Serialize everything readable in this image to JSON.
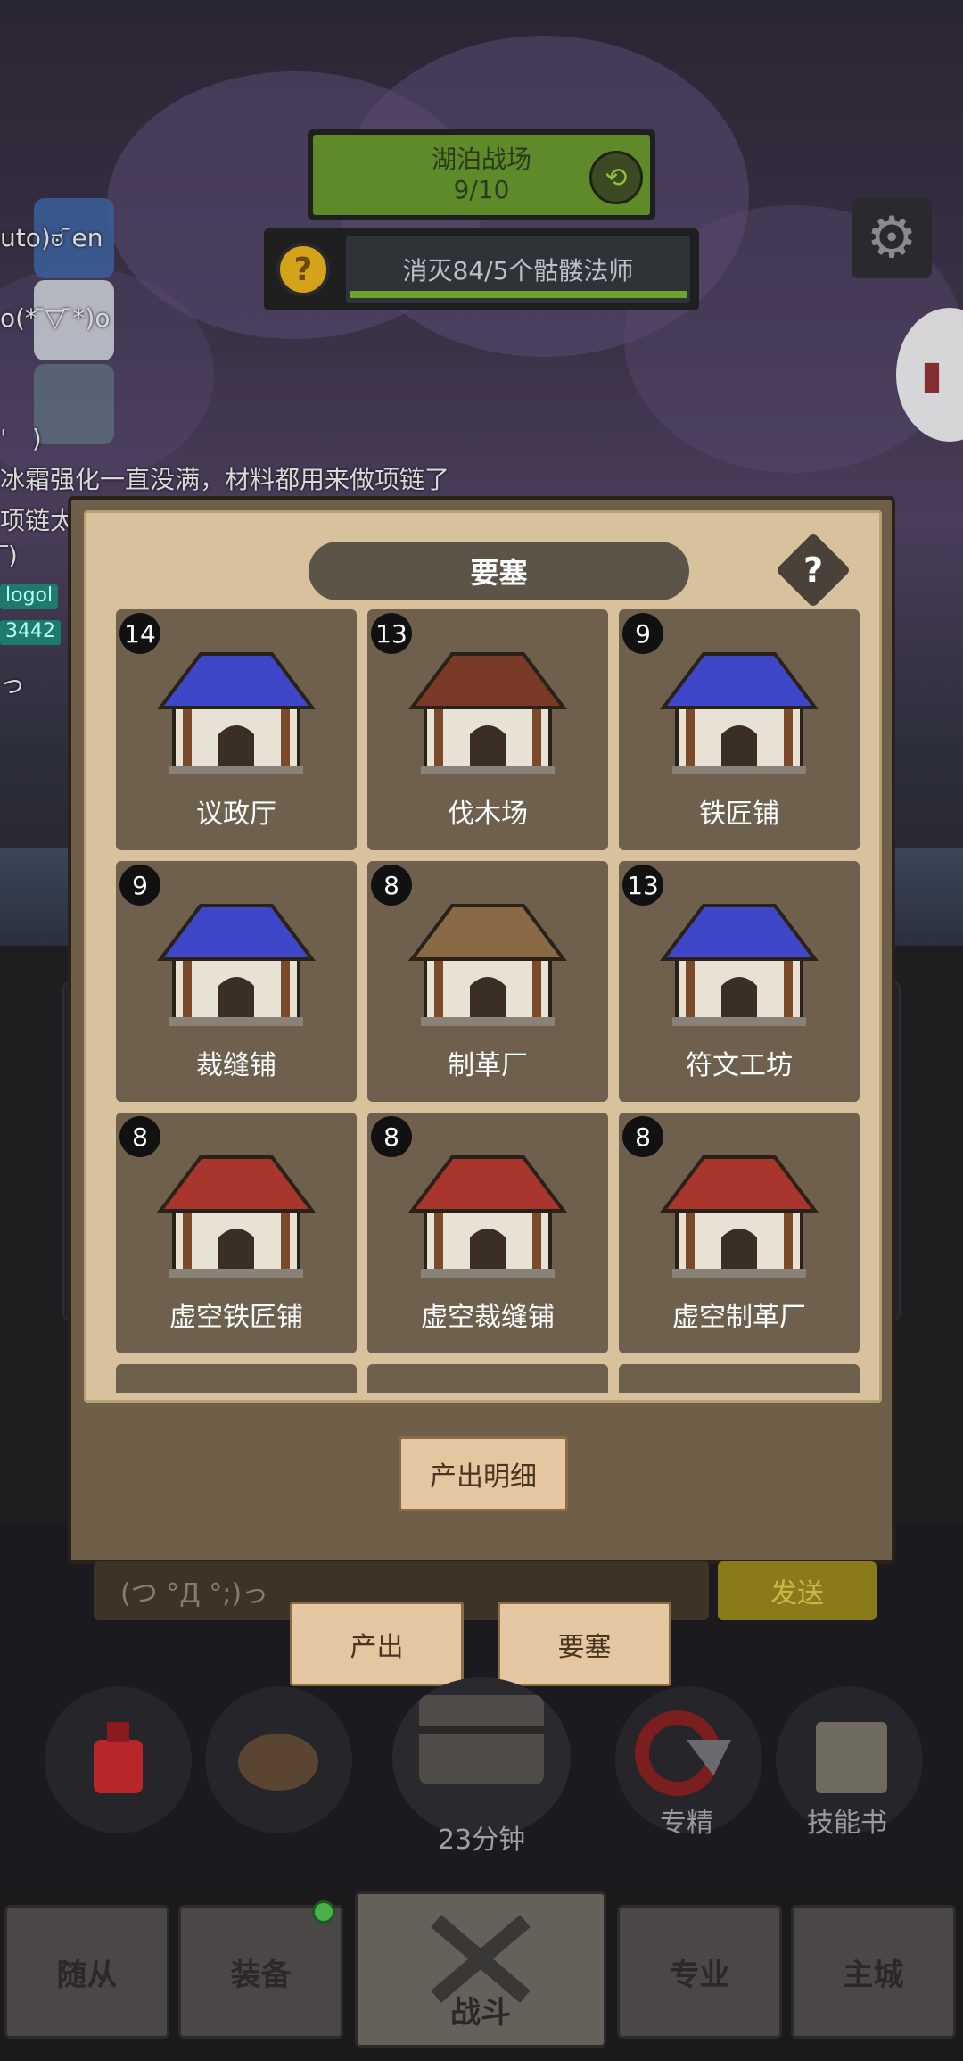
{
  "stage": {
    "name": "湖泊战场",
    "progress": "9/10"
  },
  "quest": {
    "text": "消灭84/5个骷髅法师",
    "fill_fraction": 1.0
  },
  "chat": {
    "lines": [
      "uto)ಠ ̄en",
      "o(*  ̄▽ ̄*)o",
      "'　)",
      "冰霜强化一直没满，材料都用来做项链了",
      "项链太",
      "̅ ̅)",
      "）",
      "っ"
    ],
    "badges": [
      "logol",
      "3442"
    ],
    "input_placeholder": "(つ °Д °;)っ",
    "send_label": "发送"
  },
  "modal": {
    "title": "要塞",
    "help_symbol": "?",
    "buildings": [
      {
        "name": "议政厅",
        "level": "14",
        "icon": "town-hall-icon",
        "roof": "#3e47c8"
      },
      {
        "name": "伐木场",
        "level": "13",
        "icon": "lumber-mill-icon",
        "roof": "#7a3a28"
      },
      {
        "name": "铁匠铺",
        "level": "9",
        "icon": "blacksmith-icon",
        "roof": "#3e47c8"
      },
      {
        "name": "裁缝铺",
        "level": "9",
        "icon": "tailor-shop-icon",
        "roof": "#3e47c8"
      },
      {
        "name": "制革厂",
        "level": "8",
        "icon": "tannery-icon",
        "roof": "#8a6a44"
      },
      {
        "name": "符文工坊",
        "level": "13",
        "icon": "rune-workshop-icon",
        "roof": "#3e47c8"
      },
      {
        "name": "虚空铁匠铺",
        "level": "8",
        "icon": "void-blacksmith-icon",
        "roof": "#a8362c"
      },
      {
        "name": "虚空裁缝铺",
        "level": "8",
        "icon": "void-tailor-icon",
        "roof": "#a8362c"
      },
      {
        "name": "虚空制革厂",
        "level": "8",
        "icon": "void-tannery-icon",
        "roof": "#a8362c"
      }
    ],
    "detail_button": "产出明细"
  },
  "tabs": {
    "output": "产出",
    "fortress": "要塞"
  },
  "actions": {
    "timer": "23分钟",
    "specialize": "专精",
    "skill_book": "技能书"
  },
  "nav": {
    "followers": "随从",
    "equipment": "装备",
    "battle": "战斗",
    "profession": "专业",
    "main_city": "主城"
  },
  "colors": {
    "panel": "#d8c29d",
    "card": "#6e604d",
    "stage_green": "#5e8a2a",
    "quest_gold": "#d4a31a"
  }
}
